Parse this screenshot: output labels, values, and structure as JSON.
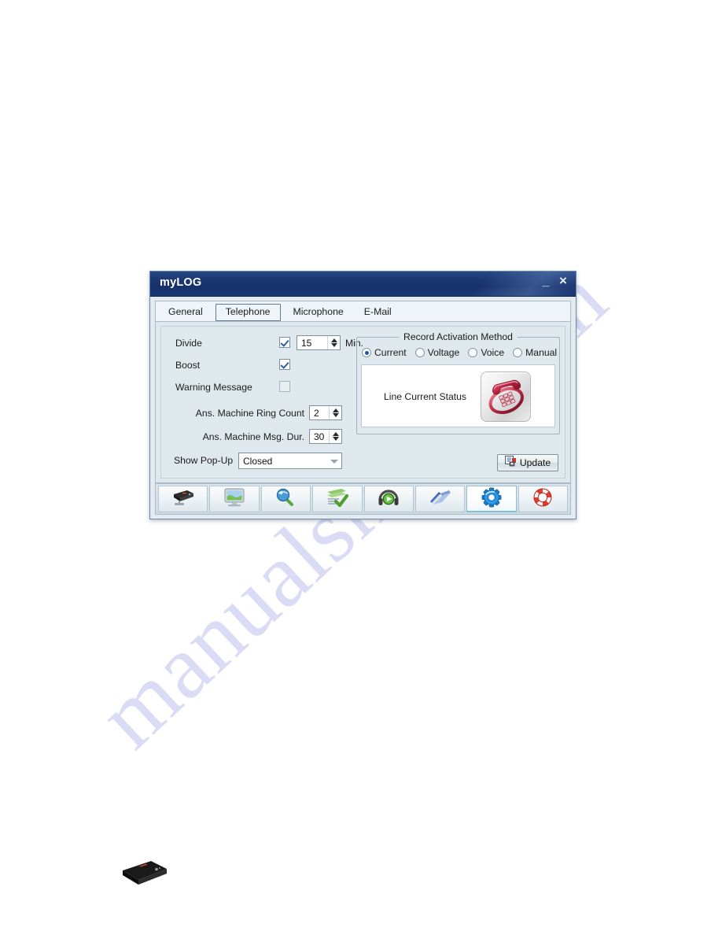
{
  "watermark": {
    "text": "manualshive.com"
  },
  "window": {
    "title": "myLOG",
    "minimize_label": "_",
    "close_label": "×"
  },
  "tabs": [
    {
      "label": "General",
      "selected": false
    },
    {
      "label": "Telephone",
      "selected": true
    },
    {
      "label": "Microphone",
      "selected": false
    },
    {
      "label": "E-Mail",
      "selected": false
    }
  ],
  "form": {
    "divide": {
      "label": "Divide",
      "checked": true,
      "value": "15",
      "unit": "Min."
    },
    "boost": {
      "label": "Boost",
      "checked": true
    },
    "warning_message": {
      "label": "Warning Message",
      "checked": false
    },
    "ans_machine_ring_count": {
      "label": "Ans. Machine Ring Count",
      "value": "2"
    },
    "ans_machine_msg_dur": {
      "label": "Ans. Machine Msg. Dur.",
      "value": "30"
    },
    "show_popup": {
      "label": "Show Pop-Up",
      "value": "Closed"
    }
  },
  "activation": {
    "legend": "Record Activation Method",
    "options": [
      {
        "label": "Current",
        "selected": true
      },
      {
        "label": "Voltage",
        "selected": false
      },
      {
        "label": "Voice",
        "selected": false
      },
      {
        "label": "Manual",
        "selected": false
      }
    ],
    "status_label": "Line Current Status",
    "status_icon": "telephone-icon"
  },
  "update_button": {
    "label": "Update",
    "icon": "save-document-icon"
  },
  "toolbar": [
    {
      "icon": "recorder-device-icon",
      "active": false
    },
    {
      "icon": "monitor-icon",
      "active": false
    },
    {
      "icon": "search-magnifier-icon",
      "active": false
    },
    {
      "icon": "checklist-icon",
      "active": false
    },
    {
      "icon": "headphones-play-icon",
      "active": false
    },
    {
      "icon": "address-book-icon",
      "active": false
    },
    {
      "icon": "settings-gear-icon",
      "active": true
    },
    {
      "icon": "lifebuoy-help-icon",
      "active": false
    }
  ],
  "page": {
    "device_photo_icon": "black-recorder-device-photo"
  },
  "colors": {
    "titlebar": "#1d3a74",
    "panel_bg": "#dfe8ed",
    "accent_blue": "#23559e",
    "phone_red": "#b8223f",
    "toolbar_active": "#7fc0d8"
  }
}
